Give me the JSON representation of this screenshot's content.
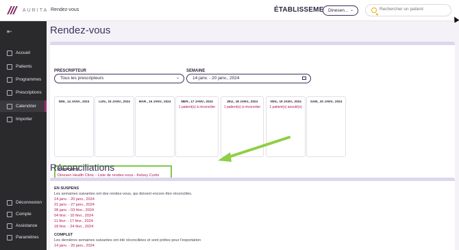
{
  "header": {
    "logo_text": "AURITA",
    "breadcrumb": "Rendez-vous",
    "establishment_label": "ÉTABLISSEMENT",
    "establishment_value": "Dinesen...",
    "search_placeholder": "Rechercher un patient"
  },
  "sidebar": {
    "items": [
      {
        "label": "Accueil"
      },
      {
        "label": "Patients"
      },
      {
        "label": "Programmes"
      },
      {
        "label": "Prescriptions"
      },
      {
        "label": "Calendrier"
      },
      {
        "label": "Importer"
      }
    ],
    "bottom": [
      {
        "label": "Déconnexion"
      },
      {
        "label": "Compte"
      },
      {
        "label": "Assistance"
      },
      {
        "label": "Paramètres"
      }
    ]
  },
  "page": {
    "title": "Rendez-vous",
    "prescripteur_label": "PRESCRIPTEUR",
    "prescripteur_value": "Tous les prescripteurs",
    "semaine_label": "SEMAINE",
    "semaine_value": "14 janv. - 20 janv., 2024",
    "days": [
      {
        "name": "DIM., 14 JANV., 2024",
        "note": ""
      },
      {
        "name": "LUN., 15 JANV., 2024",
        "note": ""
      },
      {
        "name": "MAR., 16 JANV., 2024",
        "note": ""
      },
      {
        "name": "MER., 17 JANV., 2024",
        "note": "1 patient(s) à réconcilier"
      },
      {
        "name": "JEU., 18 JANV., 2024",
        "note": "1 patient(s) à réconcilier"
      },
      {
        "name": "VEN., 19 JANV., 2024",
        "note": "1 patient(s) annulé(s)"
      },
      {
        "name": "SAM., 20 JANV., 2024",
        "note": ""
      }
    ],
    "rapports_title": "RAPPORTS",
    "rapports_link": "Dinesen Health Clinic - Liste de rendez-vous - Kelsey Curtis"
  },
  "reconciliations": {
    "title": "Réconciliations",
    "pending_title": "EN SUSPENS",
    "pending_desc": "Les semaines suivantes ont des rendez-vous, qui doivent encore être réconciliés.",
    "pending_weeks": [
      "14 janv. - 20 janv., 2024",
      "21 janv. - 27 janv., 2024",
      "28 janv. - 03 févr., 2024",
      "04 févr. - 10 févr., 2024",
      "11 févr. - 17 févr., 2024",
      "18 févr. - 24 févr., 2024"
    ],
    "complete_title": "COMPLET",
    "complete_desc": "Les dernières semaines suivantes ont été réconciliées et sont prêtes pour l'exportation",
    "complete_weeks": [
      "14 janv. - 20 janv., 2024"
    ]
  },
  "colors": {
    "accent": "#b0174f",
    "highlight": "#7ec850",
    "sidebar_bg": "#2a2a2c"
  }
}
